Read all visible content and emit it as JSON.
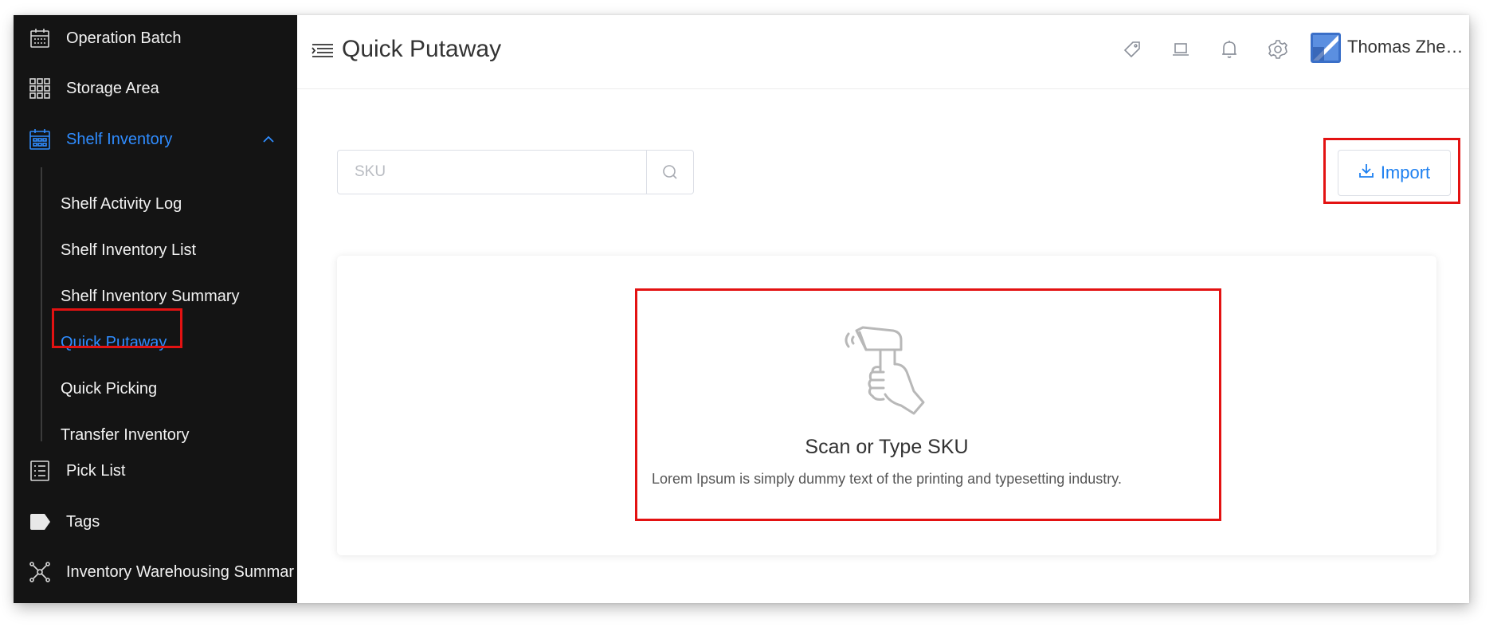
{
  "sidebar": {
    "items": [
      {
        "label": "Operation Batch",
        "icon": "calendar-icon"
      },
      {
        "label": "Storage Area",
        "icon": "grid-icon"
      },
      {
        "label": "Shelf Inventory",
        "icon": "calendar-grid-icon",
        "expanded": true
      },
      {
        "label": "Pick List",
        "icon": "list-icon"
      },
      {
        "label": "Tags",
        "icon": "tag-icon"
      },
      {
        "label": "Inventory Warehousing Summar",
        "icon": "network-icon"
      }
    ],
    "sub_items": [
      {
        "label": "Shelf Activity Log"
      },
      {
        "label": "Shelf Inventory List"
      },
      {
        "label": "Shelf Inventory Summary"
      },
      {
        "label": "Quick Putaway",
        "active": true
      },
      {
        "label": "Quick Picking"
      },
      {
        "label": "Transfer Inventory"
      }
    ]
  },
  "header": {
    "title": "Quick Putaway",
    "icons": [
      "tag-icon",
      "laptop-icon",
      "bell-icon",
      "settings-icon"
    ],
    "user_name": "Thomas Zhenhu..."
  },
  "search": {
    "placeholder": "SKU",
    "value": ""
  },
  "toolbar": {
    "import_label": "Import"
  },
  "empty_state": {
    "icon": "barcode-scanner-icon",
    "title": "Scan or Type SKU",
    "description": "Lorem Ipsum is simply dummy text of the printing and typesetting industry."
  },
  "colors": {
    "sidebar_bg": "#141414",
    "active": "#2f8cff",
    "highlight": "#e31212",
    "primary": "#1e80f0"
  }
}
